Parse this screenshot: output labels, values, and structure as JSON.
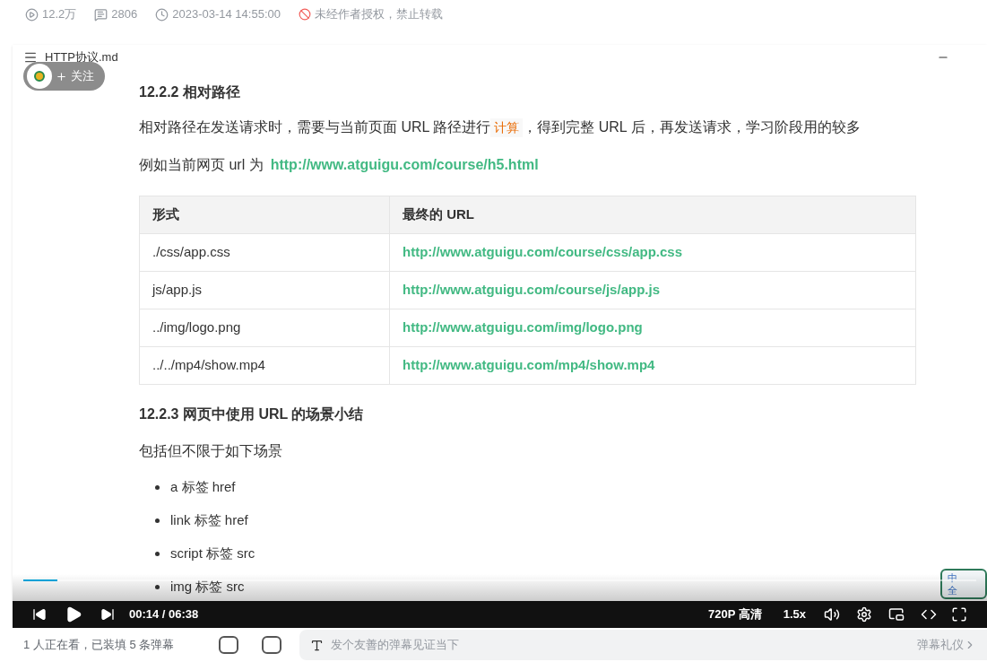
{
  "meta": {
    "views": "12.2万",
    "danmaku_count": "2806",
    "date": "2023-03-14 14:55:00",
    "notice": "未经作者授权，禁止转载"
  },
  "document": {
    "filename": "HTTP协议.md",
    "follow_label": "关注",
    "heading1": "12.2.2 相对路径",
    "paragraph_parts": [
      "相对路径在发送请求时，需要与当前页面 URL 路径进行",
      "计算",
      "，得到完整 URL 后，再发送请求，学习阶段用的较多"
    ],
    "example_label": "例如当前网页 url 为",
    "example_url": "http://www.atguigu.com/course/h5.html",
    "table": {
      "columns": [
        "形式",
        "最终的 URL"
      ],
      "rows": [
        [
          "./css/app.css",
          "http://www.atguigu.com/course/css/app.css"
        ],
        [
          "js/app.js",
          "http://www.atguigu.com/course/js/app.js"
        ],
        [
          "../img/logo.png",
          "http://www.atguigu.com/img/logo.png"
        ],
        [
          "../../mp4/show.mp4",
          "http://www.atguigu.com/mp4/show.mp4"
        ]
      ]
    },
    "heading2": "12.2.3 网页中使用 URL 的场景小结",
    "intro": "包括但不限于如下场景",
    "list": [
      "a 标签 href",
      "link 标签 href",
      "script 标签 src",
      "img 标签 src"
    ]
  },
  "ime": {
    "row1": "中",
    "row2": "全"
  },
  "player": {
    "progress": {
      "level": 0.036
    },
    "time": "00:14 / 06:38",
    "quality": "720P 高清",
    "speed": "1.5x"
  },
  "footer": {
    "watching": "1 人正在看，已装填 5 条弹幕",
    "danmaku_placeholder": "发个友善的弹幕见证当下",
    "etiquette": "弹幕礼仪"
  }
}
